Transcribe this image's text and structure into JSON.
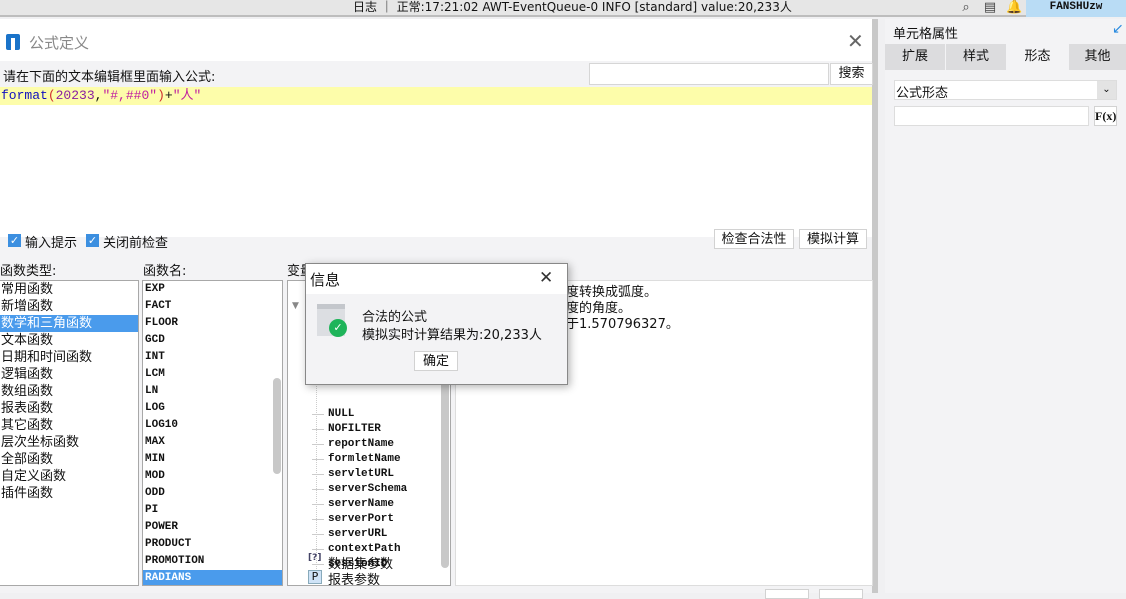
{
  "topbar": {
    "status": "日志 ｜ 正常:17:21:02 AWT-EventQueue-0 INFO [standard] value:20,233人",
    "user": "FANSHUzw",
    "icons": [
      "search-icon",
      "notes-icon",
      "bell-icon"
    ]
  },
  "dialog": {
    "title": "公式定义",
    "prompt": "请在下面的文本编辑框里面输入公式:",
    "search_placeholder": "",
    "search_button": "搜索",
    "formula": {
      "func": "format",
      "open": "(",
      "num": "20233",
      "comma": ",",
      "str": "\"#,##0\"",
      "close": ")",
      "plus": "+",
      "str2": "\"人\""
    },
    "checkbox_hint": "输入提示",
    "checkbox_check": "关闭前检查",
    "btn_validate": "检查合法性",
    "btn_simulate": "模拟计算",
    "categories_label": "函数类型:",
    "functions_label": "函数名:",
    "variables_label": "变量",
    "categories": [
      "常用函数",
      "新增函数",
      "数学和三角函数",
      "文本函数",
      "日期和时间函数",
      "逻辑函数",
      "数组函数",
      "报表函数",
      "其它函数",
      "层次坐标函数",
      "全部函数",
      "自定义函数",
      "插件函数"
    ],
    "selected_category": 2,
    "functions": [
      "EXP",
      "FACT",
      "FLOOR",
      "GCD",
      "INT",
      "LCM",
      "LN",
      "LOG",
      "LOG10",
      "MAX",
      "MIN",
      "MOD",
      "ODD",
      "PI",
      "POWER",
      "PRODUCT",
      "PROMOTION",
      "RADIANS"
    ],
    "selected_function": 17,
    "variables": [
      "NULL",
      "NOFILTER",
      "reportName",
      "formletName",
      "servletURL",
      "serverSchema",
      "serverName",
      "serverPort",
      "serverURL",
      "contextPath",
      "sessionID"
    ],
    "dataset_params": "数据集参数",
    "report_params": "报表参数",
    "description": [
      "度转换成弧度。",
      "度的角度。",
      "于1.570796327。"
    ]
  },
  "message": {
    "title": "信息",
    "line1": "合法的公式",
    "line2": "模拟实时计算结果为:20,233人",
    "ok": "确定"
  },
  "right_panel": {
    "title": "单元格属性",
    "tabs": [
      "扩展",
      "样式",
      "形态",
      "其他"
    ],
    "active_tab": 2,
    "select_value": "公式形态",
    "fx_button": "F(x)"
  }
}
